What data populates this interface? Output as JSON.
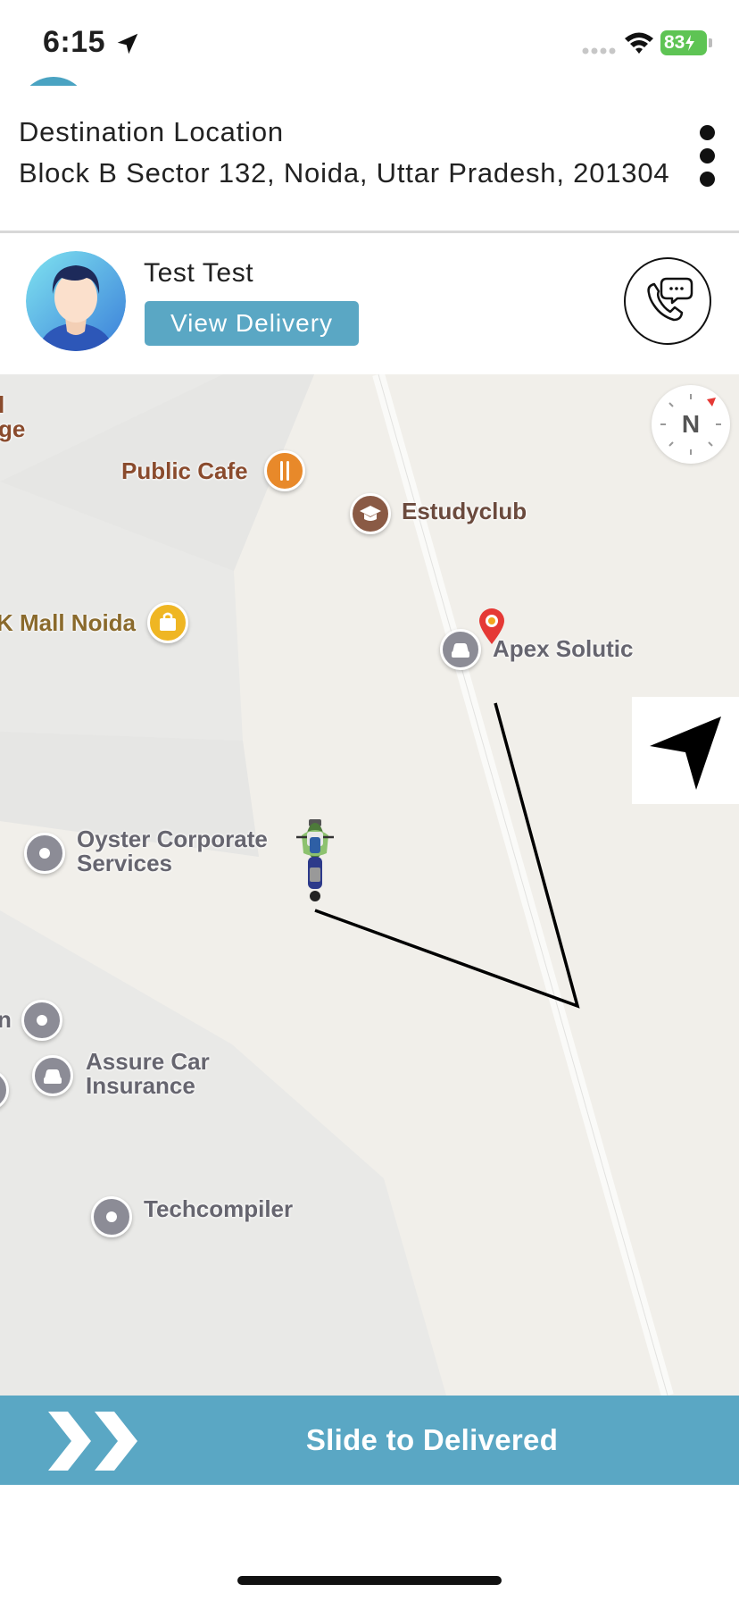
{
  "status_bar": {
    "time": "6:15",
    "battery": "83"
  },
  "destination": {
    "label": "Destination Location",
    "address": "Block B Sector 132, Noida, Uttar Pradesh, 201304"
  },
  "customer": {
    "name": "Test Test",
    "view_button": "View Delivery"
  },
  "map": {
    "compass_label": "N",
    "pois": [
      {
        "label": "ge",
        "icon": "place-icon"
      },
      {
        "label": "Public Cafe",
        "icon": "fork-knife-icon"
      },
      {
        "label": "Estudyclub",
        "icon": "graduation-cap-icon"
      },
      {
        "label": "K Mall Noida",
        "icon": "shopping-bag-icon"
      },
      {
        "label": "Apex Solutic",
        "icon": "car-icon"
      },
      {
        "label": "Oyster Corporate",
        "label2": "Services",
        "icon": "dot-icon"
      },
      {
        "label": "n",
        "icon": "dot-icon"
      },
      {
        "label": "Assure Car",
        "label2": "Insurance",
        "icon": "car-icon"
      },
      {
        "label": "Techcompiler",
        "icon": "dot-icon"
      }
    ],
    "colors": {
      "land": "#eeedea",
      "road": "#f8f8f6",
      "route": "#000000",
      "destination_pin": "#e53935"
    }
  },
  "slide_bar": {
    "label": "Slide to Delivered",
    "color": "#5aa7c4"
  }
}
